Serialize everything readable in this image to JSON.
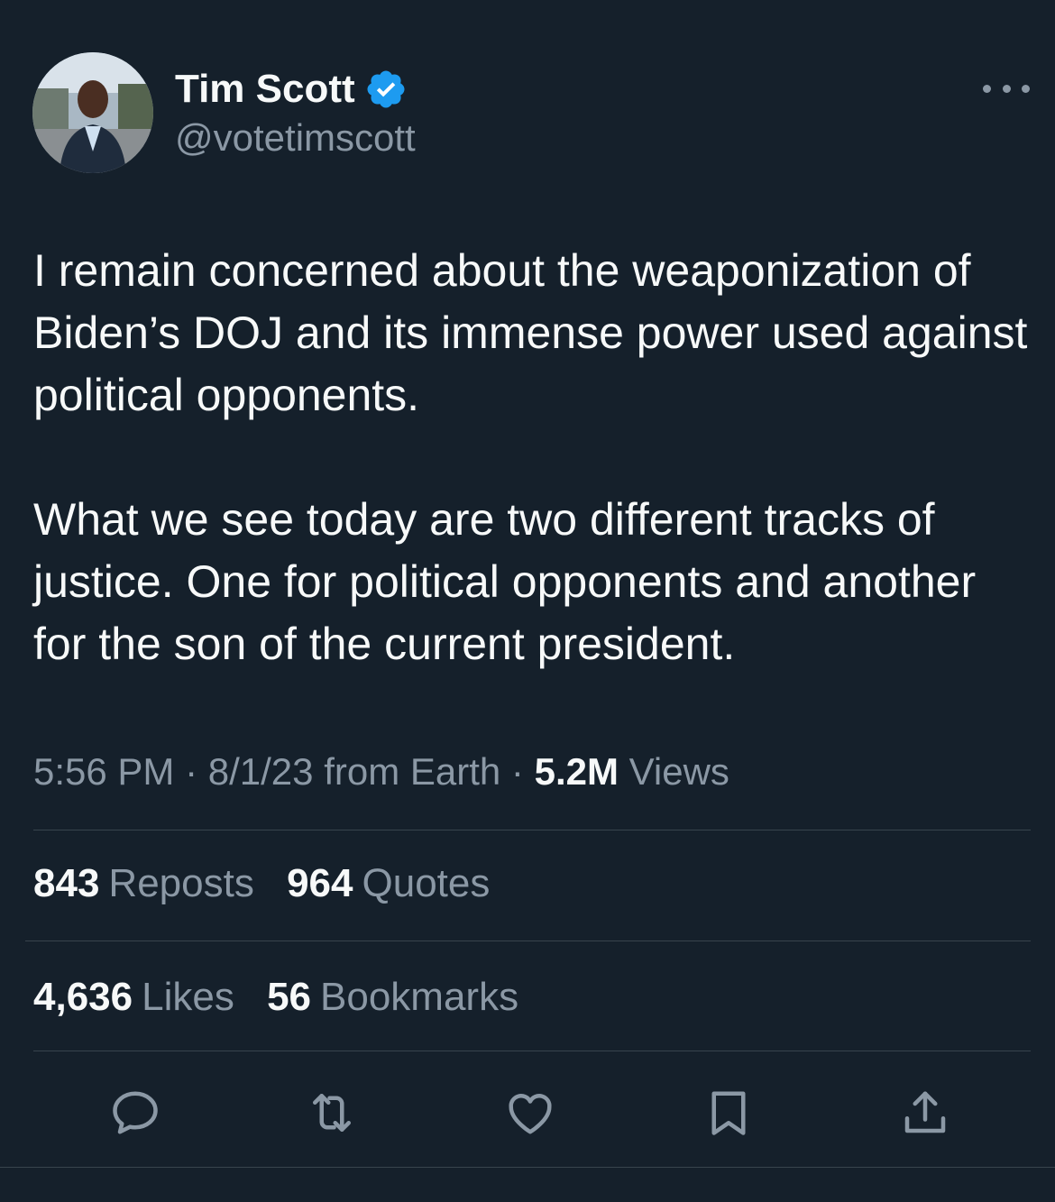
{
  "author": {
    "display_name": "Tim Scott",
    "handle": "@votetimscott",
    "verified": true
  },
  "tweet": {
    "paragraphs": [
      "I remain concerned about the weaponization of Biden’s DOJ and its immense power used against political opponents.",
      "What we see today are two different tracks of justice. One for political opponents and another for the son of the current president."
    ]
  },
  "meta": {
    "time": "5:56 PM",
    "sep1": " · ",
    "date": "8/1/23",
    "source": " from Earth",
    "sep2": " · ",
    "views_count": "5.2M",
    "views_label": " Views"
  },
  "stats": {
    "reposts_count": "843",
    "reposts_label": "Reposts",
    "quotes_count": "964",
    "quotes_label": "Quotes",
    "likes_count": "4,636",
    "likes_label": "Likes",
    "bookmarks_count": "56",
    "bookmarks_label": "Bookmarks"
  },
  "icons": {
    "reply": "reply-icon",
    "repost": "repost-icon",
    "like": "heart-icon",
    "bookmark": "bookmark-icon",
    "share": "share-icon",
    "verified": "verified-badge-icon",
    "more": "more-icon"
  },
  "colors": {
    "background": "#15202b",
    "text_primary": "#f7f9f9",
    "text_secondary": "#8b98a5",
    "divider": "#38444d",
    "verified_blue": "#1d9bf0"
  }
}
